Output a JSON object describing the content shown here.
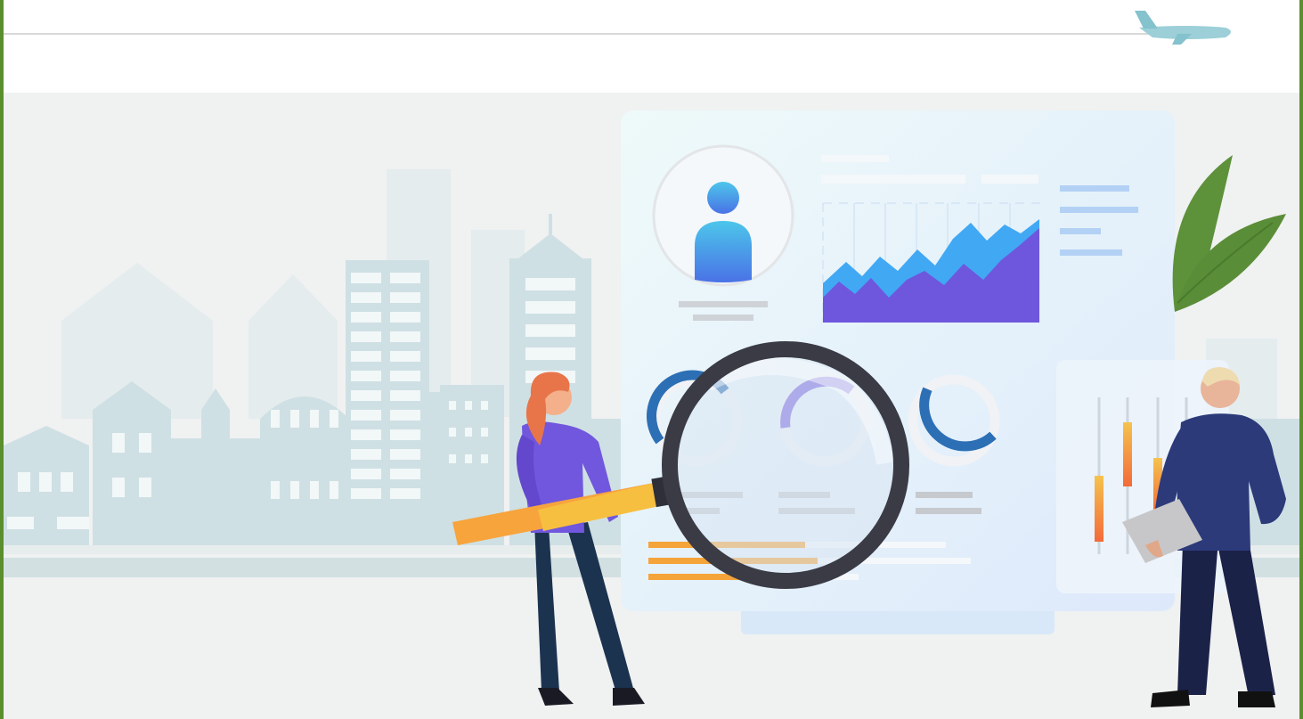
{
  "illustration": {
    "subject": "analytics-dashboard-with-magnifier",
    "colors": {
      "frame": "#5b8f2e",
      "background": "#f0f1f1",
      "city": "#d2e2e6",
      "card": "#e6f1fa",
      "accent_purple": "#6f5ad8",
      "accent_blue": "#3aa6f2",
      "accent_orange": "#f5a43a",
      "leaf": "#5d913a",
      "lens_ring": "#3a3b45"
    },
    "chart_series_indicator": [
      0.45,
      0.3,
      0.7,
      0.55
    ]
  }
}
